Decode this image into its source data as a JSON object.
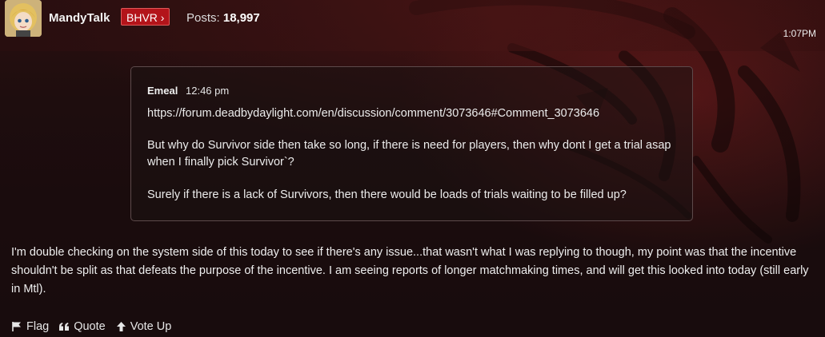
{
  "post": {
    "author": "MandyTalk",
    "role_badge": "BHVR ›",
    "posts_label": "Posts:",
    "posts_count": "18,997",
    "timestamp": "1:07PM"
  },
  "quote": {
    "author": "Emeal",
    "date": "12:46 pm",
    "link": "https://forum.deadbydaylight.com/en/discussion/comment/3073646#Comment_3073646",
    "paragraph_1": "But why do Survivor side then take so long, if there is need for players, then why dont I get a trial asap when I finally pick Survivor`?",
    "paragraph_2": "Surely if there is a lack of Survivors, then there would be loads of trials waiting to be filled up?"
  },
  "body": {
    "text": "I'm double checking on the system side of this today to see if there's any issue...that wasn't what I was replying to though, my point was that the incentive shouldn't be split as that defeats the purpose of the incentive. I am seeing reports of longer matchmaking times, and will get this looked into today (still early in Mtl)."
  },
  "actions": {
    "flag": "Flag",
    "quote": "Quote",
    "vote_up": "Vote Up"
  },
  "icons": {
    "flag": "flag-icon",
    "quote": "quote-icon",
    "vote_up": "arrow-up-icon"
  },
  "colors": {
    "badge": "#b3141a",
    "background": "#1c0c0d"
  }
}
